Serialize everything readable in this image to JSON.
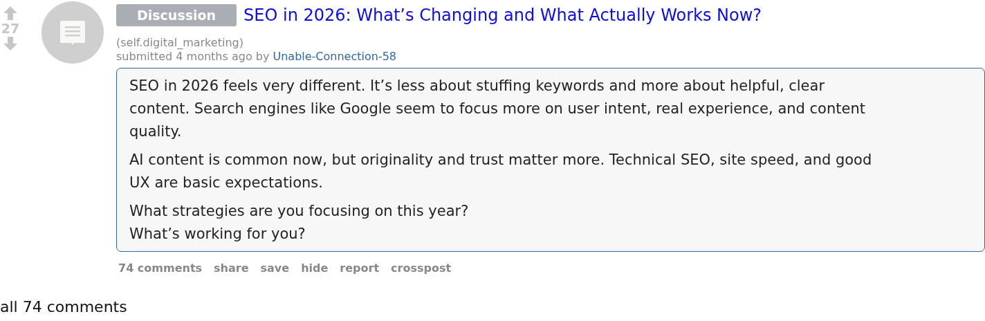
{
  "vote": {
    "score": "27"
  },
  "post": {
    "flair": "Discussion",
    "title": "SEO in 2026: What’s Changing and What Actually Works Now?",
    "domain": "(self.digital_marketing)",
    "submitted": "submitted 4 months ago by",
    "author": "Unable-Connection-58",
    "body": [
      [
        "SEO in 2026 feels very different. It’s less about stuffing keywords and more about helpful, clear",
        "content. Search engines like Google seem to focus more on user intent, real experience, and content",
        "quality."
      ],
      [
        "AI content is common now, but originality and trust matter more. Technical SEO, site speed, and good",
        "UX are basic expectations."
      ],
      [
        "What strategies are you focusing on this year?",
        "What’s working for you?"
      ]
    ],
    "actions": [
      "74 comments",
      "share",
      "save",
      "hide",
      "report",
      "crosspost"
    ]
  },
  "comments_heading": "all 74 comments"
}
